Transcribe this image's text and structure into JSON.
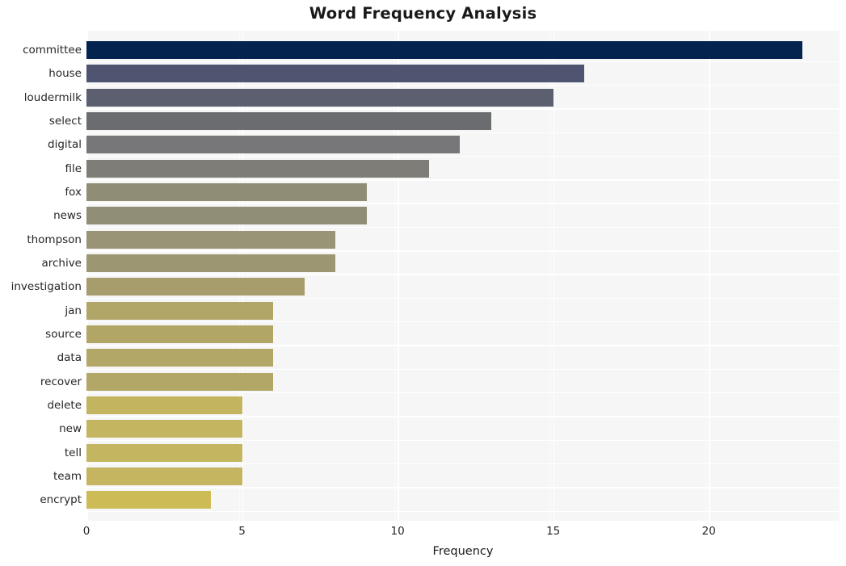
{
  "chart_data": {
    "type": "bar",
    "orientation": "horizontal",
    "title": "Word Frequency Analysis",
    "xlabel": "Frequency",
    "ylabel": "",
    "categories": [
      "committee",
      "house",
      "loudermilk",
      "select",
      "digital",
      "file",
      "fox",
      "news",
      "thompson",
      "archive",
      "investigation",
      "jan",
      "source",
      "data",
      "recover",
      "delete",
      "new",
      "tell",
      "team",
      "encrypt"
    ],
    "values": [
      23,
      16,
      15,
      13,
      12,
      11,
      9,
      9,
      8,
      8,
      7,
      6,
      6,
      6,
      6,
      5,
      5,
      5,
      5,
      4
    ],
    "bar_colors": [
      "#05234f",
      "#4f5470",
      "#5b5f6f",
      "#6b6c70",
      "#77777a",
      "#7e7d77",
      "#908d76",
      "#918e77",
      "#9a9476",
      "#9c9673",
      "#a79d6c",
      "#b1a667",
      "#b2a667",
      "#b3a768",
      "#b3a768",
      "#c3b45f",
      "#c4b560",
      "#c4b560",
      "#c5b561",
      "#cdbb55"
    ],
    "xlim": [
      0,
      24.2
    ],
    "xticks": [
      0,
      5,
      10,
      15,
      20
    ],
    "xtick_labels": [
      "0",
      "5",
      "10",
      "15",
      "20"
    ],
    "grid": true,
    "grid_color": "#ffffff",
    "plot_background": "#f6f6f6",
    "figure_background": "#ffffff",
    "legend": null
  },
  "figure": {
    "title": "Word Frequency Analysis",
    "xlabel": "Frequency"
  }
}
